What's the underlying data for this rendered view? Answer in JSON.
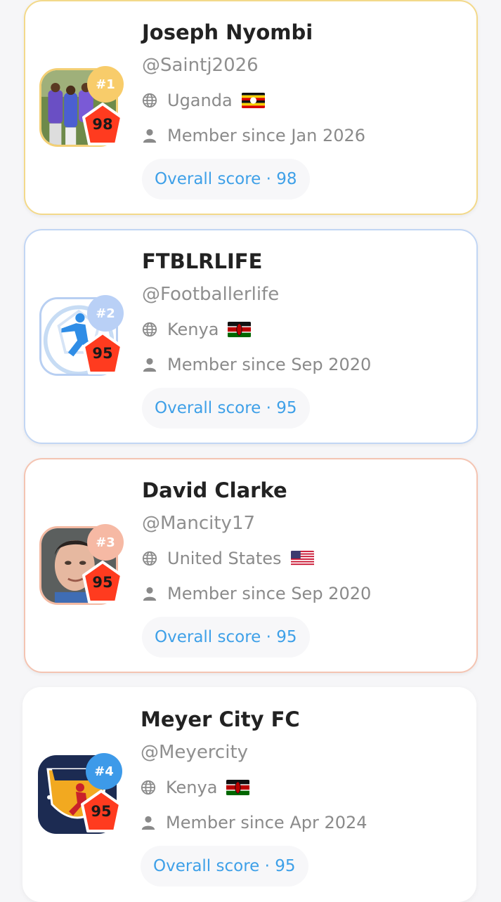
{
  "users": [
    {
      "rank": "#1",
      "score": "98",
      "name": "Joseph Nyombi",
      "handle": "@Saintj2026",
      "country": "Uganda",
      "member_since": "Member since Jan 2026",
      "overall": "Overall score · 98",
      "flag_icon": "uganda-flag"
    },
    {
      "rank": "#2",
      "score": "95",
      "name": "FTBLRLIFE",
      "handle": "@Footballerlife",
      "country": "Kenya",
      "member_since": "Member since Sep 2020",
      "overall": "Overall score · 95",
      "flag_icon": "kenya-flag"
    },
    {
      "rank": "#3",
      "score": "95",
      "name": "David Clarke",
      "handle": "@Mancity17",
      "country": "United States",
      "member_since": "Member since Sep 2020",
      "overall": "Overall score · 95",
      "flag_icon": "usa-flag"
    },
    {
      "rank": "#4",
      "score": "95",
      "name": "Meyer City FC",
      "handle": "@Meyercity",
      "country": "Kenya",
      "member_since": "Member since Apr 2024",
      "overall": "Overall score · 95",
      "flag_icon": "kenya-flag"
    }
  ],
  "colors": {
    "gold": "#f3d98a",
    "silver": "#c2d6f4",
    "bronze": "#f4c4b2",
    "accent": "#3ea0e8",
    "score_badge": "#ff3b1f"
  }
}
